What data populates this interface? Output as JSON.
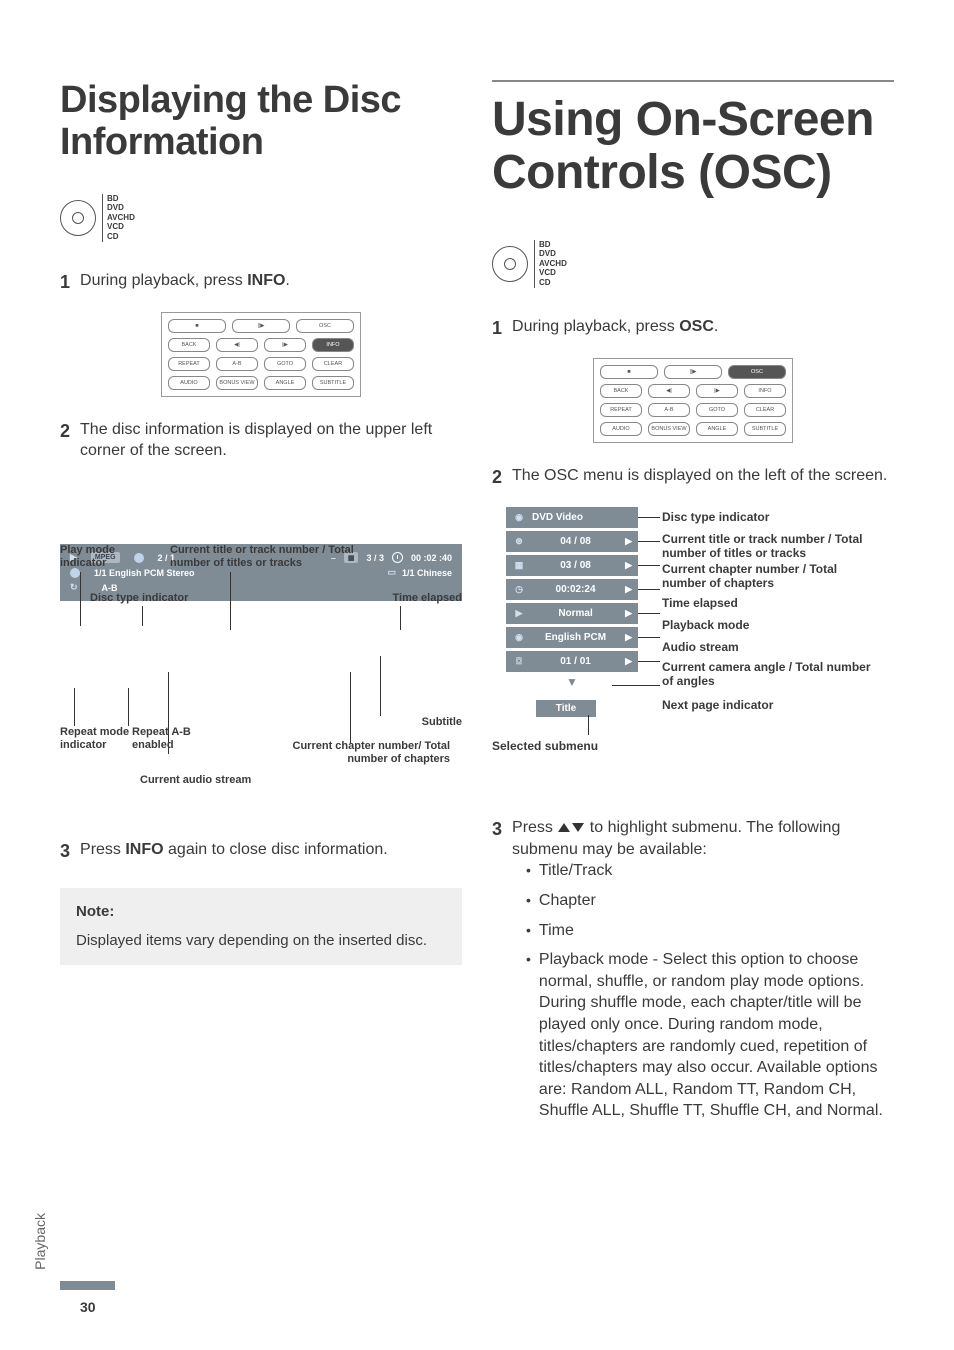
{
  "sideTab": "Playback",
  "pageNumber": "30",
  "left": {
    "title": "Displaying the Disc Information",
    "discFormats": [
      "BD",
      "DVD",
      "AVCHD",
      "VCD",
      "CD"
    ],
    "step1_pre": "During playback, press ",
    "step1_bold": "INFO",
    "step1_post": ".",
    "remote_selected": "INFO",
    "step2": "The disc information  is displayed on the upper left corner of the screen.",
    "diagram": {
      "playMode": "Play mode indicator",
      "titleTrack": "Current title or track number / Total number of titles or tracks",
      "discType": "Disc type indicator",
      "timeElapsed": "Time elapsed",
      "repeatMode": "Repeat mode indicator",
      "repeatAB": "Repeat A-B enabled",
      "subtitle": "Subtitle",
      "chapterNum": "Current chapter number/ Total number of chapters",
      "audioStream": "Current audio stream",
      "bar": {
        "mpeg": "MPEG",
        "titleNums": "2  /  1",
        "chapNums": "3  /  3",
        "time": "00 :02 :40",
        "audio": "1/1  English  PCM  Stereo",
        "sub": "1/1  Chinese",
        "ab": "A-B"
      }
    },
    "step3_pre": "Press ",
    "step3_bold": "INFO",
    "step3_post": " again to close disc information.",
    "noteTitle": "Note:",
    "noteBody": "Displayed items vary depending on the inserted disc."
  },
  "right": {
    "title": "Using On-Screen Controls (OSC)",
    "discFormats": [
      "BD",
      "DVD",
      "AVCHD",
      "VCD",
      "CD"
    ],
    "step1_pre": "During playback, press ",
    "step1_bold": "OSC",
    "step1_post": ".",
    "remote_selected": "OSC",
    "step2": "The OSC menu is displayed on the left of the screen.",
    "oscMenu": {
      "header": "DVD Video",
      "items": [
        {
          "value": "04 / 08"
        },
        {
          "value": "03 / 08"
        },
        {
          "value": "00:02:24"
        },
        {
          "value": "Normal"
        },
        {
          "value": "English PCM"
        },
        {
          "value": "01 / 01"
        }
      ],
      "sub": "Title",
      "selectedSubmenu": "Selected submenu",
      "labels": {
        "discType": "Disc type indicator",
        "titleTrack": "Current title or track number / Total number of titles or tracks",
        "chapter": "Current chapter number / Total number of chapters",
        "timeElapsed": "Time elapsed",
        "playbackMode": "Playback mode",
        "audioStream": "Audio stream",
        "cameraAngle": "Current camera angle / Total number of angles",
        "nextPage": "Next page indicator"
      }
    },
    "step3_pre": "Press ",
    "step3_post": " to highlight submenu. The following submenu may be available:",
    "bullets": [
      "Title/Track",
      "Chapter",
      "Time",
      "Playback mode - Select this option to choose normal, shuffle, or random play mode options. During shuffle mode, each chapter/title will be played only once. During random mode, titles/chapters are randomly cued, repetition of titles/chapters may also occur. Available options are: Random ALL, Random TT, Random CH, Shuffle ALL, Shuffle TT, Shuffle CH, and Normal."
    ]
  },
  "remoteButtons": {
    "row1": [
      "■",
      "||▶",
      "OSC"
    ],
    "row2": [
      "BACK",
      "◀|",
      "|▶",
      "INFO"
    ],
    "row3": [
      "REPEAT",
      "A-B",
      "GOTO",
      "CLEAR"
    ],
    "row4": [
      "AUDIO",
      "BONUS VIEW",
      "ANGLE",
      "SUBTITLE"
    ]
  }
}
